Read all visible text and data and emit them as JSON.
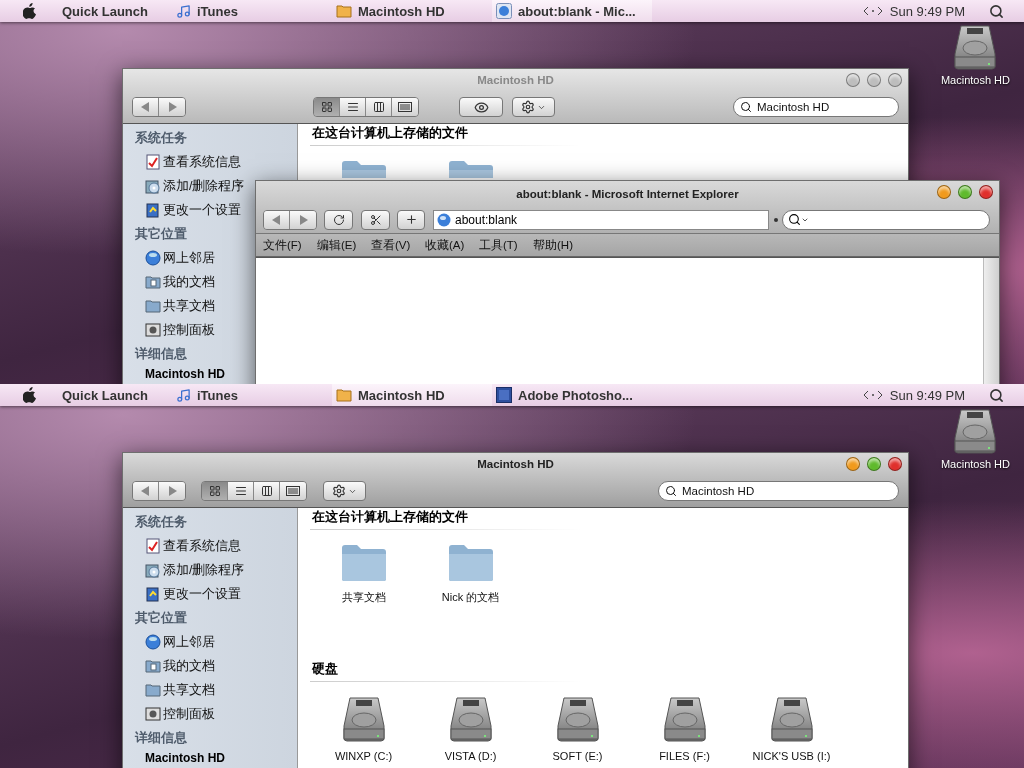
{
  "screens": [
    {
      "menubar": {
        "quick_launch": "Quick Launch",
        "apps": [
          {
            "kind": "itunes",
            "label": "iTunes",
            "selected": false
          },
          {
            "kind": "folder",
            "label": "Macintosh HD",
            "selected": false
          },
          {
            "kind": "ie",
            "label": "about:blank - Mic...",
            "selected": true
          }
        ],
        "clock": "Sun 9:49 PM"
      },
      "desktop_icons": [
        {
          "label": "Macintosh HD"
        }
      ],
      "finder": {
        "title": "Macintosh HD",
        "active": false,
        "quick_look": true,
        "view_buttons": [
          {
            "kind": "icons",
            "selected": true
          },
          {
            "kind": "list",
            "selected": false
          },
          {
            "kind": "columns",
            "selected": false
          },
          {
            "kind": "coverflow",
            "selected": false
          }
        ],
        "search": {
          "value": "Macintosh HD"
        },
        "sidebar": [
          {
            "title": "系统任务",
            "items": [
              {
                "kind": "info",
                "label": "查看系统信息"
              },
              {
                "kind": "addremove",
                "label": "添加/删除程序"
              },
              {
                "kind": "settings",
                "label": "更改一个设置"
              }
            ]
          },
          {
            "title": "其它位置",
            "items": [
              {
                "kind": "network",
                "label": "网上邻居"
              },
              {
                "kind": "mydocs",
                "label": "我的文档"
              },
              {
                "kind": "shared",
                "label": "共享文档"
              },
              {
                "kind": "control",
                "label": "控制面板"
              }
            ]
          },
          {
            "title": "详细信息",
            "items": [
              {
                "kind": "name",
                "label": "Macintosh HD"
              }
            ]
          }
        ],
        "sections": [
          {
            "title": "在这台计算机上存储的文件",
            "items": [
              {
                "kind": "folder"
              },
              {
                "kind": "folder"
              }
            ]
          }
        ]
      },
      "browser": {
        "title": "about:blank - Microsoft Internet Explorer",
        "active": true,
        "address": "about:blank",
        "menu": [
          "文件(F)",
          "编辑(E)",
          "查看(V)",
          "收藏(A)",
          "工具(T)",
          "帮助(H)"
        ]
      }
    },
    {
      "menubar": {
        "quick_launch": "Quick Launch",
        "apps": [
          {
            "kind": "itunes",
            "label": "iTunes",
            "selected": false
          },
          {
            "kind": "folder",
            "label": "Macintosh HD",
            "selected": true
          },
          {
            "kind": "photoshop",
            "label": "Adobe Photosho...",
            "selected": false
          }
        ],
        "clock": "Sun 9:49 PM"
      },
      "desktop_icons": [
        {
          "label": "Macintosh HD"
        }
      ],
      "finder": {
        "title": "Macintosh HD",
        "active": true,
        "quick_look": false,
        "view_buttons": [
          {
            "kind": "icons",
            "selected": true
          },
          {
            "kind": "list",
            "selected": false
          },
          {
            "kind": "columns",
            "selected": false
          },
          {
            "kind": "coverflow",
            "selected": false
          }
        ],
        "search": {
          "value": "Macintosh HD"
        },
        "sidebar": [
          {
            "title": "系统任务",
            "items": [
              {
                "kind": "info",
                "label": "查看系统信息"
              },
              {
                "kind": "addremove",
                "label": "添加/删除程序"
              },
              {
                "kind": "settings",
                "label": "更改一个设置"
              }
            ]
          },
          {
            "title": "其它位置",
            "items": [
              {
                "kind": "network",
                "label": "网上邻居"
              },
              {
                "kind": "mydocs",
                "label": "我的文档"
              },
              {
                "kind": "shared",
                "label": "共享文档"
              },
              {
                "kind": "control",
                "label": "控制面板"
              }
            ]
          },
          {
            "title": "详细信息",
            "items": [
              {
                "kind": "name",
                "label": "Macintosh HD"
              }
            ]
          }
        ],
        "sections": [
          {
            "title": "在这台计算机上存储的文件",
            "items": [
              {
                "kind": "folder",
                "label": "共享文档"
              },
              {
                "kind": "folder",
                "label": "Nick 的文档"
              }
            ]
          },
          {
            "title": "硬盘",
            "items": [
              {
                "kind": "drive",
                "label": "WINXP (C:)"
              },
              {
                "kind": "drive",
                "label": "VISTA (D:)"
              },
              {
                "kind": "drive",
                "label": "SOFT (E:)"
              },
              {
                "kind": "drive",
                "label": "FILES (F:)"
              },
              {
                "kind": "drive",
                "label": "NICK'S USB (I:)"
              }
            ]
          }
        ]
      }
    }
  ]
}
